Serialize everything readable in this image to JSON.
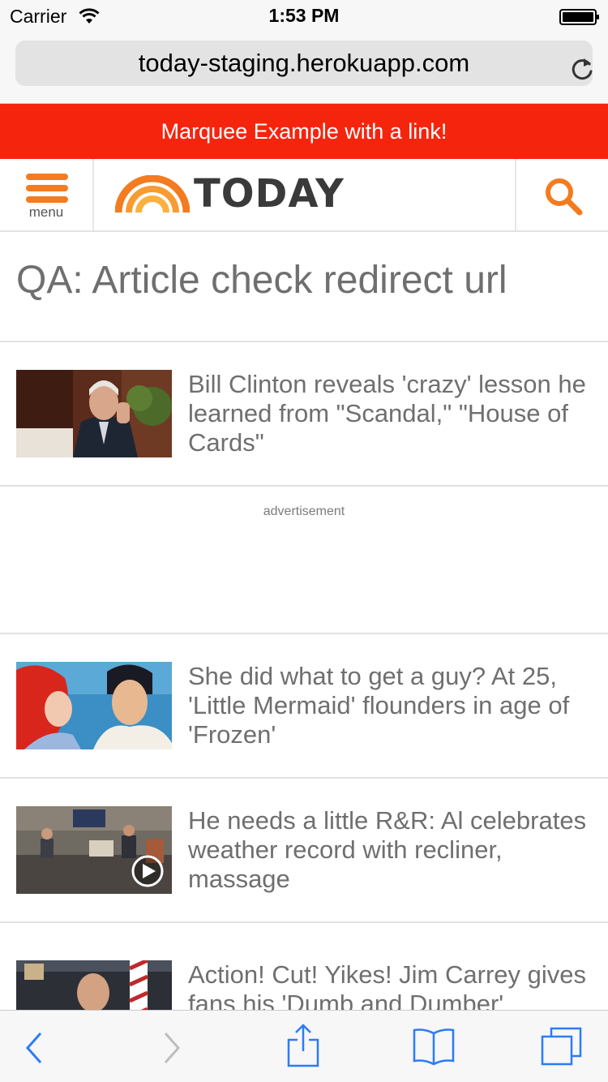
{
  "status_bar": {
    "carrier": "Carrier",
    "time": "1:53 PM",
    "icons": [
      "wifi-icon",
      "battery-icon"
    ]
  },
  "browser": {
    "url": "today-staging.herokuapp.com",
    "reload_icon": "reload-icon"
  },
  "marquee": {
    "text": "Marquee Example with a link!",
    "color": "#f5250d"
  },
  "header": {
    "menu_label": "menu",
    "logo_text": "TODAY",
    "accent_color": "#f47b20",
    "icons": [
      "menu-icon",
      "today-logo-icon",
      "search-icon"
    ]
  },
  "page": {
    "title": "QA: Article check redirect url"
  },
  "articles": [
    {
      "headline": "Bill Clinton reveals 'crazy' lesson he learned from \"Scandal,\" \"House of Cards\"",
      "has_video": false
    },
    {
      "headline": "She did what to get a guy? At 25, 'Little Mermaid' flounders in age of 'Frozen'",
      "has_video": false
    },
    {
      "headline": "He needs a little R&R: Al celebrates weather record with recliner, massage",
      "has_video": true
    },
    {
      "headline": "Action! Cut! Yikes! Jim Carrey gives fans his 'Dumb and Dumber'",
      "has_video": false
    }
  ],
  "advertisement": {
    "label": "advertisement"
  },
  "toolbar": {
    "icons": [
      "back-icon",
      "forward-icon",
      "share-icon",
      "bookmarks-icon",
      "tabs-icon"
    ],
    "tint_color": "#2b7cf6"
  }
}
